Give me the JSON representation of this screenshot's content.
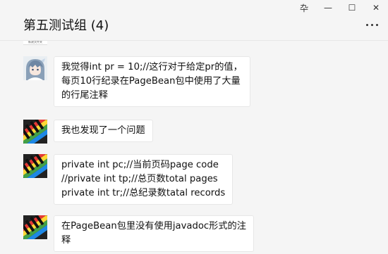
{
  "window": {
    "pin_icon": "pin-icon",
    "minimize_icon": "minimize-icon",
    "maximize_icon": "maximize-icon",
    "close_icon": "close-icon",
    "pin_glyph": "卆",
    "minimize_glyph": "—",
    "maximize_glyph": "☐",
    "close_glyph": "✕"
  },
  "header": {
    "title": "第五测试组 (4)",
    "more_icon": "more-options-icon"
  },
  "prev_avatar_caption": "新建文件夹",
  "messages": [
    {
      "avatar": "anime-girl-avatar",
      "text": "我觉得int pr = 10;//这行对于给定pr的值，\n每页10行纪录在PageBean包中使用了大量\n的行尾注释"
    },
    {
      "avatar": "piano-keys-avatar",
      "text": "我也发现了一个问题"
    },
    {
      "avatar": "piano-keys-avatar",
      "text": "private int pc;//当前页码page code\n//private int tp;//总页数total pages\nprivate int tr;//总纪录数tatal records"
    },
    {
      "avatar": "piano-keys-avatar",
      "text": "在PageBean包里没有使用javadoc形式的注\n释"
    }
  ],
  "colors": {
    "background": "#f5f5f5",
    "bubble": "#ffffff",
    "bubble_border": "#e7e7e7",
    "text": "#111111"
  }
}
